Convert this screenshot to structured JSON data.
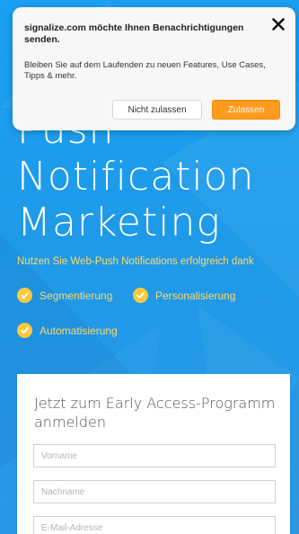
{
  "popup": {
    "title": "signalize.com möchte Ihnen Benachrichtigungen senden.",
    "body": "Bleiben Sie auf dem Laufenden zu neuen Features, Use Cases, Tipps & mehr.",
    "deny_label": "Nicht zulassen",
    "allow_label": "Zulassen",
    "close_icon": "close-icon",
    "allow_color": "#ff9b1e"
  },
  "hero": {
    "line1": "Push",
    "line2": "Notification",
    "line3": "Marketing",
    "subtitle": "Nutzen Sie Web-Push Notifications erfolgreich dank"
  },
  "features": [
    {
      "label": "Segmentierung",
      "icon": "check-circle-icon"
    },
    {
      "label": "Personalisierung",
      "icon": "check-circle-icon"
    },
    {
      "label": "Automatisierung",
      "icon": "check-circle-icon"
    }
  ],
  "form": {
    "title": "Jetzt zum Early Access-Programm anmelden",
    "first_name_placeholder": "Vorname",
    "last_name_placeholder": "Nachname",
    "email_placeholder": "E-Mail-Adresse"
  },
  "colors": {
    "background": "#1e9ae8",
    "accent_yellow": "#ffc93b",
    "feature_text": "#ffd86a"
  }
}
